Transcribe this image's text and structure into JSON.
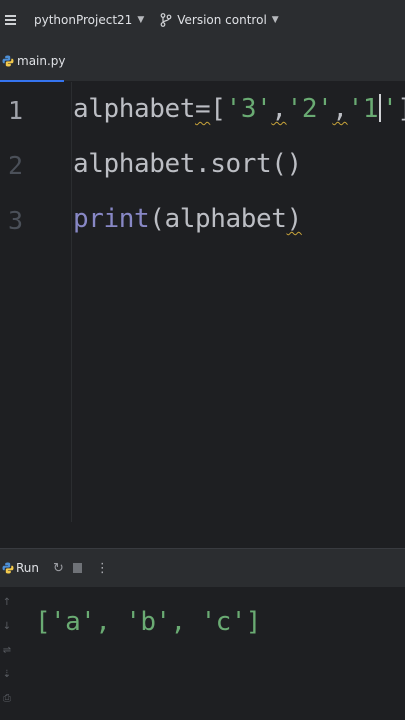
{
  "titlebar": {
    "project_name": "pythonProject21",
    "vcs_label": "Version control"
  },
  "tabs": [
    {
      "label": "main.py",
      "active": true
    }
  ],
  "editor": {
    "line_numbers": [
      "1",
      "2",
      "3"
    ],
    "lines": {
      "l1_name": "alphabet",
      "l1_eq": "=",
      "l1_open": "[",
      "l1_s1": "'3'",
      "l1_c1": ",",
      "l1_s2": "'2'",
      "l1_c2": ",",
      "l1_s3a": "'1",
      "l1_s3b": "'",
      "l1_close": "]",
      "l2": "alphabet.sort()",
      "l3_fn": "print",
      "l3_args": "(alphabet",
      "l3_close": ")"
    }
  },
  "run_panel": {
    "tab_label": "Run",
    "output": "['a', 'b', 'c']"
  },
  "colors": {
    "accent": "#3574f0",
    "string": "#6aab73",
    "builtin": "#8888c6",
    "warning": "#c9a43a"
  },
  "icons": [
    "menu-icon",
    "branch-icon",
    "python-file-icon",
    "run-icon",
    "rerun-icon",
    "stop-icon",
    "more-icon"
  ]
}
